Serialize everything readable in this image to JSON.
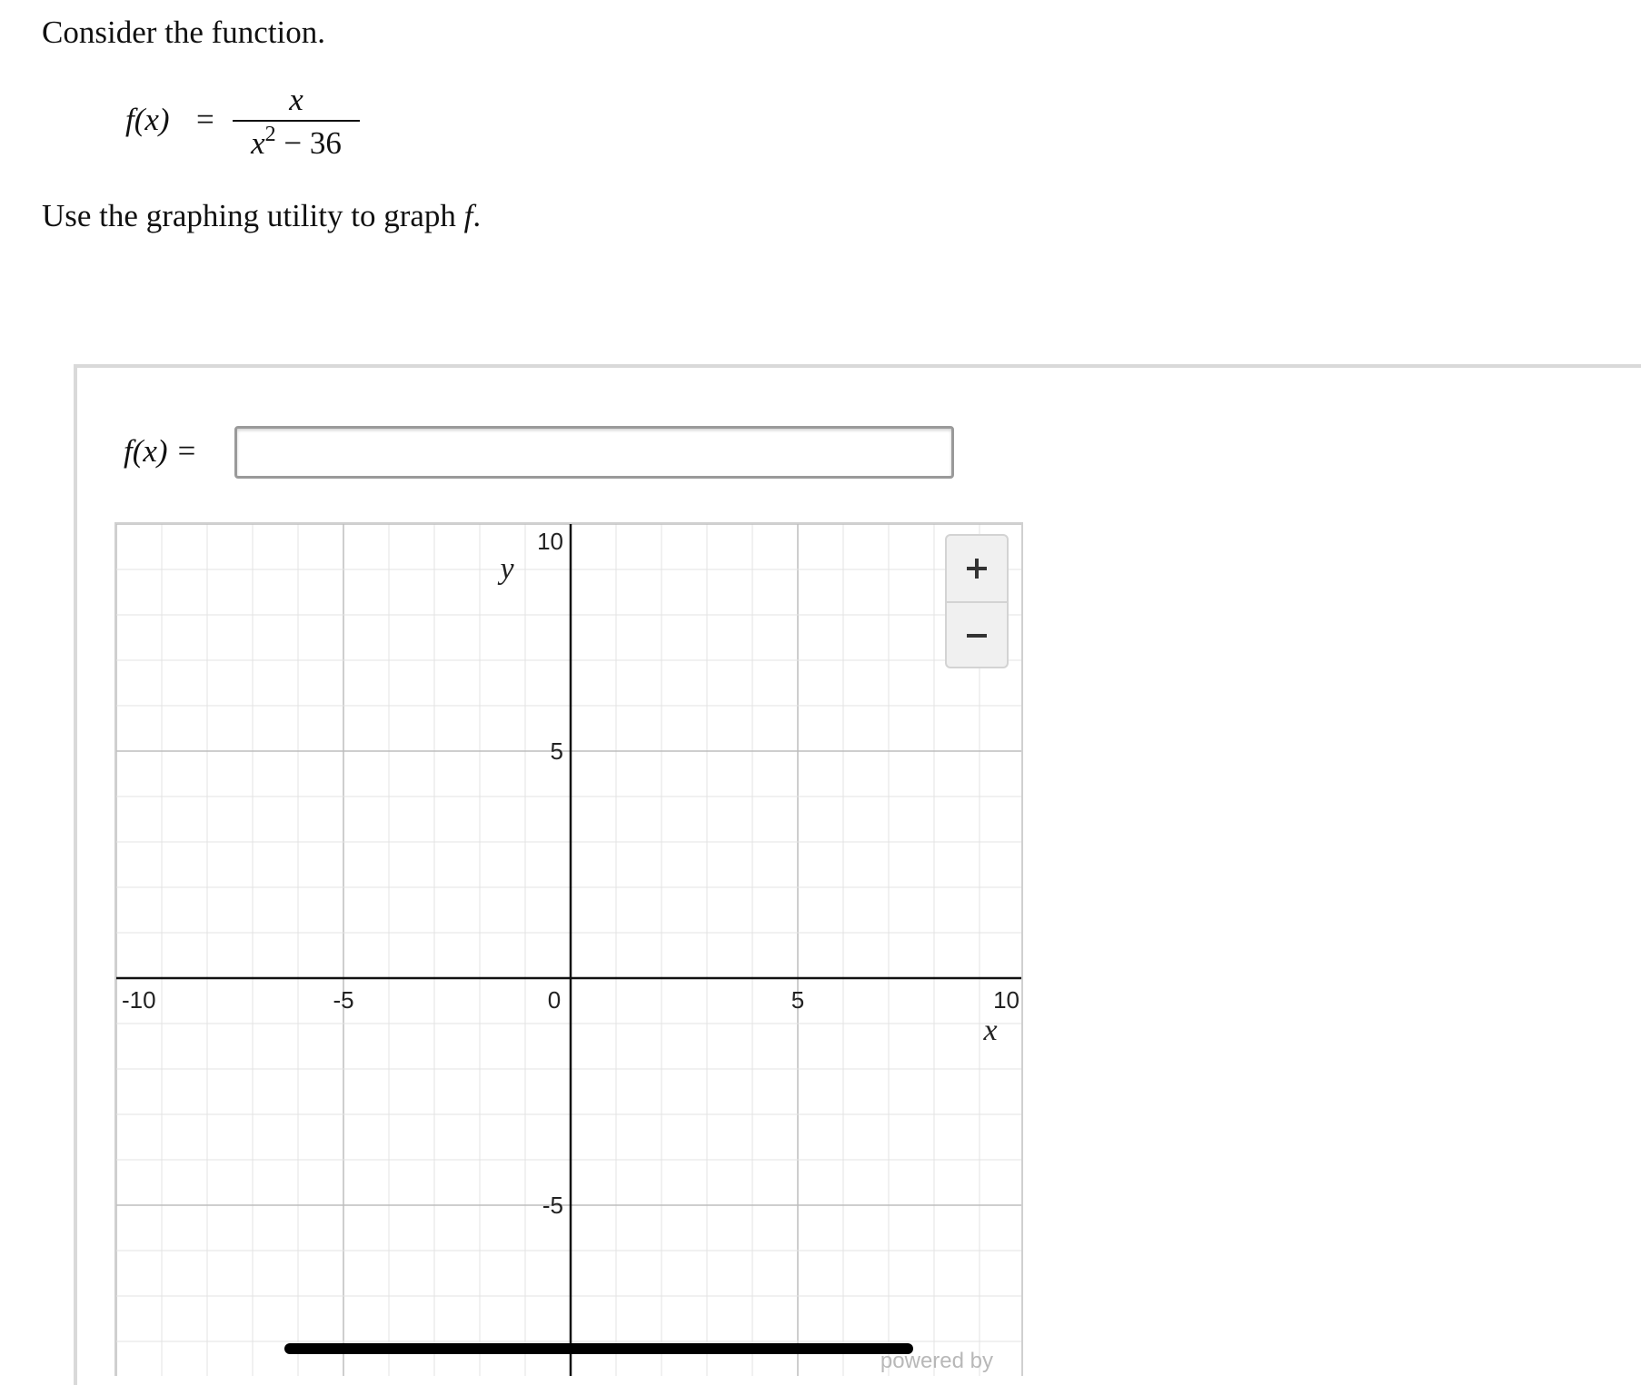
{
  "problem": {
    "intro": "Consider the function.",
    "function_lhs": "f(x)",
    "equals": "=",
    "numerator": "x",
    "denominator_var": "x",
    "denominator_exp": "2",
    "denominator_rest": " − 36",
    "instruction_prefix": "Use the graphing utility to graph ",
    "instruction_var": "f",
    "instruction_suffix": "."
  },
  "utility": {
    "input_label": "f(x) =",
    "input_value": "",
    "input_placeholder": ""
  },
  "graph": {
    "x_axis_name": "x",
    "y_axis_name": "y",
    "x_range": [
      -10,
      10
    ],
    "y_visible_range": [
      -8.5,
      10
    ],
    "minor_grid_step": 1,
    "major_grid_step": 5,
    "x_tick_labels": [
      {
        "value": -10,
        "label": "-10"
      },
      {
        "value": -5,
        "label": "-5"
      },
      {
        "value": 0,
        "label": "0"
      },
      {
        "value": 5,
        "label": "5"
      },
      {
        "value": 10,
        "label": "10"
      }
    ],
    "y_tick_labels": [
      {
        "value": 10,
        "label": "10"
      },
      {
        "value": 5,
        "label": "5"
      },
      {
        "value": -5,
        "label": "-5"
      }
    ],
    "zoom_in_icon": "plus-icon",
    "zoom_out_icon": "minus-icon",
    "watermark": "powered by"
  },
  "colors": {
    "grid_minor": "#e3e3e3",
    "grid_major": "#bdbdbd",
    "axis": "#111111",
    "text": "#111111"
  }
}
